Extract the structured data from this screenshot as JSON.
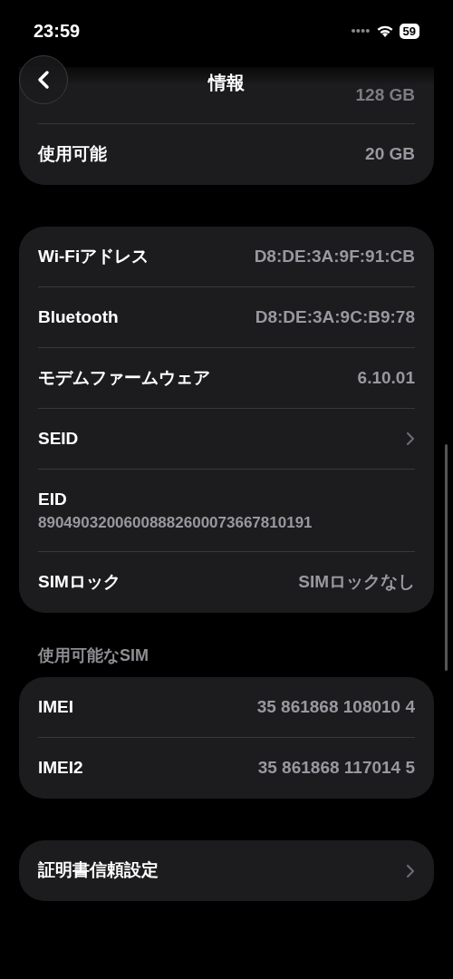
{
  "status_bar": {
    "time": "23:59",
    "battery": "59"
  },
  "nav": {
    "title": "情報"
  },
  "groups": [
    {
      "rows": [
        {
          "kind": "faded",
          "value": "128 GB"
        },
        {
          "kind": "value",
          "label": "使用可能",
          "value": "20 GB"
        }
      ]
    },
    {
      "rows": [
        {
          "kind": "value",
          "label": "Wi-Fiアドレス",
          "value": "D8:DE:3A:9F:91:CB"
        },
        {
          "kind": "value",
          "label": "Bluetooth",
          "value": "D8:DE:3A:9C:B9:78"
        },
        {
          "kind": "value",
          "label": "モデムファームウェア",
          "value": "6.10.01"
        },
        {
          "kind": "chevron",
          "label": "SEID"
        },
        {
          "kind": "stacked",
          "label": "EID",
          "value": "89049032006008882600073667810191"
        },
        {
          "kind": "value",
          "label": "SIMロック",
          "value": "SIMロックなし"
        }
      ]
    },
    {
      "header": "使用可能なSIM",
      "rows": [
        {
          "kind": "value",
          "label": "IMEI",
          "value": "35 861868 108010 4"
        },
        {
          "kind": "value",
          "label": "IMEI2",
          "value": "35 861868 117014 5"
        }
      ]
    },
    {
      "rows": [
        {
          "kind": "chevron",
          "label": "証明書信頼設定"
        }
      ]
    }
  ]
}
